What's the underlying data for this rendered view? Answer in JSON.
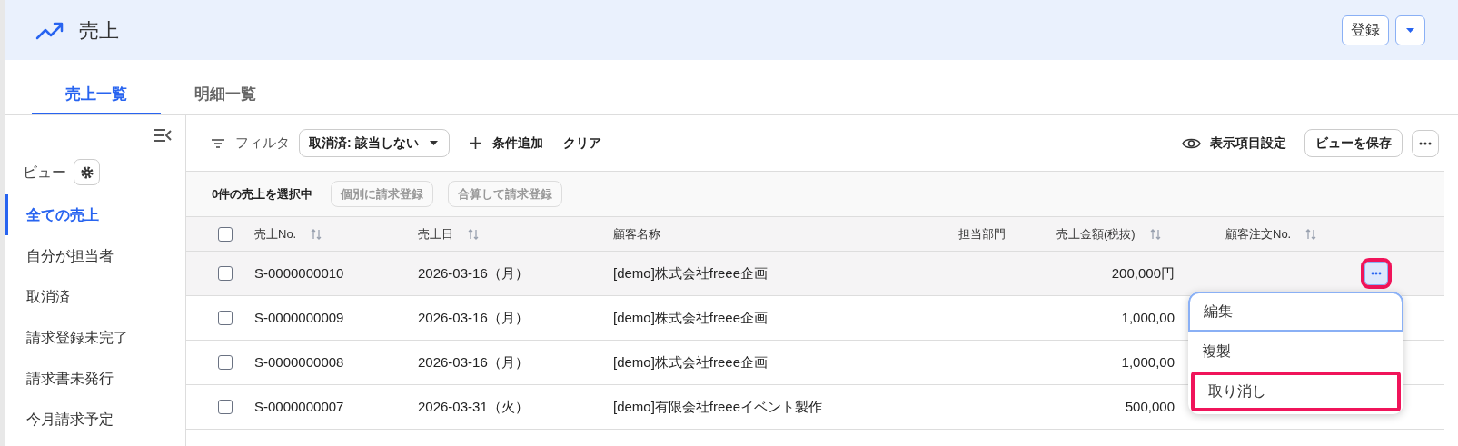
{
  "header": {
    "title": "売上",
    "register_button": "登録"
  },
  "tabs": [
    {
      "label": "売上一覧",
      "selected": true
    },
    {
      "label": "明細一覧",
      "selected": false
    }
  ],
  "sidebar": {
    "view_label": "ビュー",
    "items": [
      {
        "label": "全ての売上",
        "selected": true
      },
      {
        "label": "自分が担当者",
        "selected": false
      },
      {
        "label": "取消済",
        "selected": false
      },
      {
        "label": "請求登録未完了",
        "selected": false
      },
      {
        "label": "請求書未発行",
        "selected": false
      },
      {
        "label": "今月請求予定",
        "selected": false
      }
    ]
  },
  "filter_bar": {
    "label": "フィルタ",
    "chip": "取消済: 該当しない",
    "add_condition": "条件追加",
    "clear": "クリア",
    "column_settings": "表示項目設定",
    "save_view": "ビューを保存"
  },
  "selection_bar": {
    "count_text": "0件の売上を選択中",
    "buttons": [
      {
        "label": "個別に請求登録",
        "disabled": true
      },
      {
        "label": "合算して請求登録",
        "disabled": true
      }
    ]
  },
  "table": {
    "all_checked": false,
    "columns": [
      {
        "label": "売上No.",
        "sortable": true
      },
      {
        "label": "売上日",
        "sortable": true
      },
      {
        "label": "顧客名称",
        "sortable": false
      },
      {
        "label": "担当部門",
        "sortable": false
      },
      {
        "label": "売上金額(税抜)",
        "sortable": true
      },
      {
        "label": "顧客注文No.",
        "sortable": true
      }
    ],
    "rows": [
      {
        "sales_no": "S-0000000010",
        "date": "2026-03-16（月）",
        "customer": "[demo]株式会社freee企画",
        "amount": "200,000円",
        "checked": false,
        "menu_open": true
      },
      {
        "sales_no": "S-0000000009",
        "date": "2026-03-16（月）",
        "customer": "[demo]株式会社freee企画",
        "amount": "1,000,00",
        "checked": false,
        "menu_open": false
      },
      {
        "sales_no": "S-0000000008",
        "date": "2026-03-16（月）",
        "customer": "[demo]株式会社freee企画",
        "amount": "1,000,00",
        "checked": false,
        "menu_open": false
      },
      {
        "sales_no": "S-0000000007",
        "date": "2026-03-31（火）",
        "customer": "[demo]有限会社freeeイベント製作",
        "amount": "500,000",
        "checked": false,
        "menu_open": false
      }
    ]
  },
  "row_menu": {
    "button_highlighted": true,
    "items": [
      {
        "label": "編集",
        "focused": true,
        "highlighted": false
      },
      {
        "label": "複製",
        "focused": false,
        "highlighted": false
      },
      {
        "label": "取り消し",
        "focused": false,
        "highlighted": true
      }
    ]
  }
}
